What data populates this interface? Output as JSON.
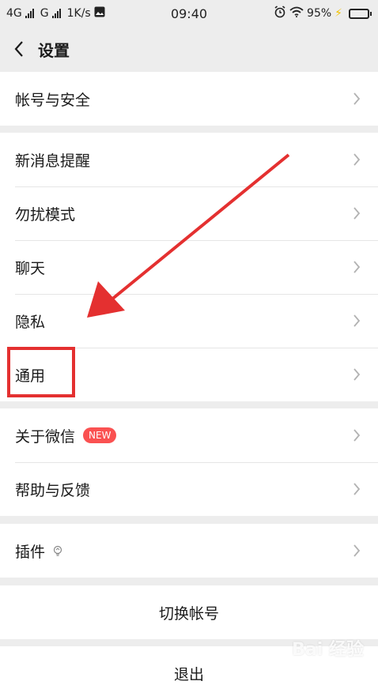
{
  "status_bar": {
    "net1": "4G",
    "net2": "G",
    "speed": "1K/s",
    "time": "09:40",
    "battery": "95%",
    "battery_level": 0.95
  },
  "nav": {
    "title": "设置"
  },
  "groups": [
    {
      "items": [
        {
          "label": "帐号与安全"
        }
      ]
    },
    {
      "items": [
        {
          "label": "新消息提醒"
        },
        {
          "label": "勿扰模式"
        },
        {
          "label": "聊天"
        },
        {
          "label": "隐私"
        },
        {
          "label": "通用"
        }
      ]
    },
    {
      "items": [
        {
          "label": "关于微信",
          "badge": "NEW"
        },
        {
          "label": "帮助与反馈"
        }
      ]
    },
    {
      "items": [
        {
          "label": "插件"
        }
      ]
    }
  ],
  "switch_account": "切换帐号",
  "logout": "退出",
  "watermark": "Bai 经验",
  "colors": {
    "background": "#ededed",
    "badge": "#fa5151",
    "annotation": "#e43030",
    "battery": "#2ecc40"
  }
}
